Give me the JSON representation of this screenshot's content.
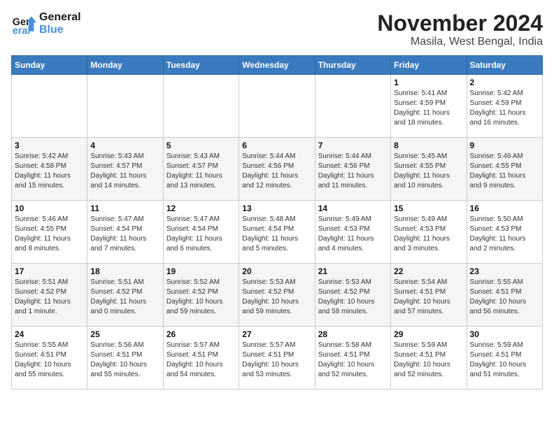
{
  "logo": {
    "line1": "General",
    "line2": "Blue"
  },
  "title": "November 2024",
  "location": "Masila, West Bengal, India",
  "weekdays": [
    "Sunday",
    "Monday",
    "Tuesday",
    "Wednesday",
    "Thursday",
    "Friday",
    "Saturday"
  ],
  "weeks": [
    [
      {
        "day": "",
        "info": ""
      },
      {
        "day": "",
        "info": ""
      },
      {
        "day": "",
        "info": ""
      },
      {
        "day": "",
        "info": ""
      },
      {
        "day": "",
        "info": ""
      },
      {
        "day": "1",
        "info": "Sunrise: 5:41 AM\nSunset: 4:59 PM\nDaylight: 11 hours\nand 18 minutes."
      },
      {
        "day": "2",
        "info": "Sunrise: 5:42 AM\nSunset: 4:59 PM\nDaylight: 11 hours\nand 16 minutes."
      }
    ],
    [
      {
        "day": "3",
        "info": "Sunrise: 5:42 AM\nSunset: 4:58 PM\nDaylight: 11 hours\nand 15 minutes."
      },
      {
        "day": "4",
        "info": "Sunrise: 5:43 AM\nSunset: 4:57 PM\nDaylight: 11 hours\nand 14 minutes."
      },
      {
        "day": "5",
        "info": "Sunrise: 5:43 AM\nSunset: 4:57 PM\nDaylight: 11 hours\nand 13 minutes."
      },
      {
        "day": "6",
        "info": "Sunrise: 5:44 AM\nSunset: 4:56 PM\nDaylight: 11 hours\nand 12 minutes."
      },
      {
        "day": "7",
        "info": "Sunrise: 5:44 AM\nSunset: 4:56 PM\nDaylight: 11 hours\nand 11 minutes."
      },
      {
        "day": "8",
        "info": "Sunrise: 5:45 AM\nSunset: 4:55 PM\nDaylight: 11 hours\nand 10 minutes."
      },
      {
        "day": "9",
        "info": "Sunrise: 5:46 AM\nSunset: 4:55 PM\nDaylight: 11 hours\nand 9 minutes."
      }
    ],
    [
      {
        "day": "10",
        "info": "Sunrise: 5:46 AM\nSunset: 4:55 PM\nDaylight: 11 hours\nand 8 minutes."
      },
      {
        "day": "11",
        "info": "Sunrise: 5:47 AM\nSunset: 4:54 PM\nDaylight: 11 hours\nand 7 minutes."
      },
      {
        "day": "12",
        "info": "Sunrise: 5:47 AM\nSunset: 4:54 PM\nDaylight: 11 hours\nand 6 minutes."
      },
      {
        "day": "13",
        "info": "Sunrise: 5:48 AM\nSunset: 4:54 PM\nDaylight: 11 hours\nand 5 minutes."
      },
      {
        "day": "14",
        "info": "Sunrise: 5:49 AM\nSunset: 4:53 PM\nDaylight: 11 hours\nand 4 minutes."
      },
      {
        "day": "15",
        "info": "Sunrise: 5:49 AM\nSunset: 4:53 PM\nDaylight: 11 hours\nand 3 minutes."
      },
      {
        "day": "16",
        "info": "Sunrise: 5:50 AM\nSunset: 4:53 PM\nDaylight: 11 hours\nand 2 minutes."
      }
    ],
    [
      {
        "day": "17",
        "info": "Sunrise: 5:51 AM\nSunset: 4:52 PM\nDaylight: 11 hours\nand 1 minute."
      },
      {
        "day": "18",
        "info": "Sunrise: 5:51 AM\nSunset: 4:52 PM\nDaylight: 11 hours\nand 0 minutes."
      },
      {
        "day": "19",
        "info": "Sunrise: 5:52 AM\nSunset: 4:52 PM\nDaylight: 10 hours\nand 59 minutes."
      },
      {
        "day": "20",
        "info": "Sunrise: 5:53 AM\nSunset: 4:52 PM\nDaylight: 10 hours\nand 59 minutes."
      },
      {
        "day": "21",
        "info": "Sunrise: 5:53 AM\nSunset: 4:52 PM\nDaylight: 10 hours\nand 58 minutes."
      },
      {
        "day": "22",
        "info": "Sunrise: 5:54 AM\nSunset: 4:51 PM\nDaylight: 10 hours\nand 57 minutes."
      },
      {
        "day": "23",
        "info": "Sunrise: 5:55 AM\nSunset: 4:51 PM\nDaylight: 10 hours\nand 56 minutes."
      }
    ],
    [
      {
        "day": "24",
        "info": "Sunrise: 5:55 AM\nSunset: 4:51 PM\nDaylight: 10 hours\nand 55 minutes."
      },
      {
        "day": "25",
        "info": "Sunrise: 5:56 AM\nSunset: 4:51 PM\nDaylight: 10 hours\nand 55 minutes."
      },
      {
        "day": "26",
        "info": "Sunrise: 5:57 AM\nSunset: 4:51 PM\nDaylight: 10 hours\nand 54 minutes."
      },
      {
        "day": "27",
        "info": "Sunrise: 5:57 AM\nSunset: 4:51 PM\nDaylight: 10 hours\nand 53 minutes."
      },
      {
        "day": "28",
        "info": "Sunrise: 5:58 AM\nSunset: 4:51 PM\nDaylight: 10 hours\nand 52 minutes."
      },
      {
        "day": "29",
        "info": "Sunrise: 5:59 AM\nSunset: 4:51 PM\nDaylight: 10 hours\nand 52 minutes."
      },
      {
        "day": "30",
        "info": "Sunrise: 5:59 AM\nSunset: 4:51 PM\nDaylight: 10 hours\nand 51 minutes."
      }
    ]
  ]
}
